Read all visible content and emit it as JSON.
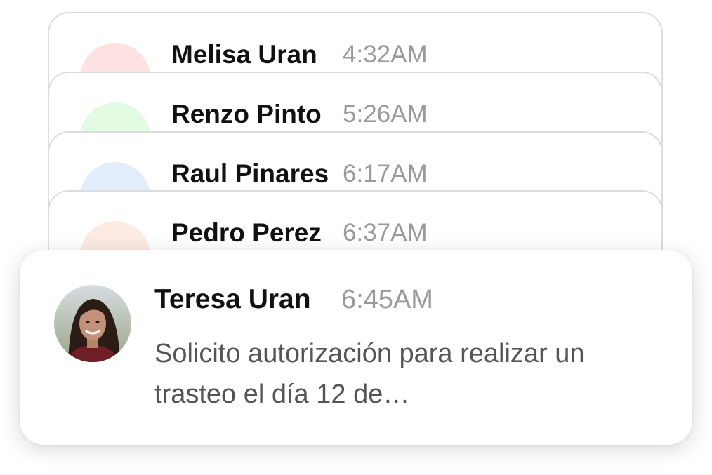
{
  "notifications": [
    {
      "name": "Melisa Uran",
      "time": "4:32AM",
      "avatar_color": "#fde2e4"
    },
    {
      "name": "Renzo Pinto",
      "time": "5:26AM",
      "avatar_color": "#e3fbe2"
    },
    {
      "name": "Raul Pinares",
      "time": "6:17AM",
      "avatar_color": "#e2eefc"
    },
    {
      "name": "Pedro Perez",
      "time": "6:37AM",
      "avatar_color": "#fdebe3"
    }
  ],
  "featured": {
    "name": "Teresa Uran",
    "time": "6:45AM",
    "message": "Solicito autorización para realizar un trasteo el día 12 de…"
  }
}
